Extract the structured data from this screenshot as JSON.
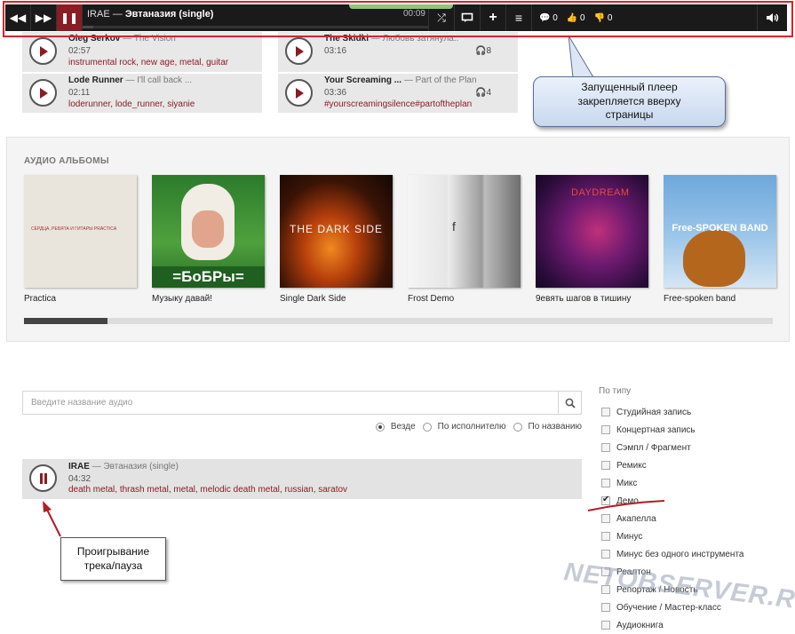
{
  "player": {
    "artist": "IRAE",
    "separator": "—",
    "title": "Эвтаназия (single)",
    "time": "00:09",
    "progress": 0.03,
    "comments": "0",
    "likes": "0",
    "dislikes": "0"
  },
  "tracks_top": [
    {
      "artist": "Oleg Serkov",
      "album": "The Vision",
      "duration": "02:57",
      "tags": "instrumental rock, new age, metal, guitar",
      "listens": ""
    },
    {
      "artist": "The Skidki",
      "album": "Любовь затянула..",
      "duration": "03:16",
      "tags": "",
      "listens": "8"
    },
    {
      "artist": "Lode Runner",
      "album": "I'll call back ...",
      "duration": "02:11",
      "tags": "loderunner, lode_runner, siyanie",
      "listens": ""
    },
    {
      "artist": "Your Screaming ...",
      "album": "Part of the Plan",
      "duration": "03:36",
      "tags": "#yourscreamingsilence#partoftheplan",
      "listens": "4"
    }
  ],
  "callout_text": "Запущенный плеер закрепляется вверху страницы",
  "albums": {
    "heading": "АУДИО АЛЬБОМЫ",
    "items": [
      {
        "name": "Practica",
        "cover_text": "СЕРДЦА, РЕБЯТА И ГИТАРЫ  PRACTICA"
      },
      {
        "name": "Музыку давай!",
        "cover_text": "=БоБРы="
      },
      {
        "name": "Single Dark Side",
        "cover_text": "THE DARK SIDE"
      },
      {
        "name": "Frost Demo",
        "cover_text": "f"
      },
      {
        "name": "9евять шагов в тишину",
        "cover_text": "DAYDREAM"
      },
      {
        "name": "Free-spoken band",
        "cover_text": "Free-SPOKEN BAND"
      }
    ]
  },
  "search": {
    "placeholder": "Введите название аудио",
    "value": ""
  },
  "radio_options": [
    "Везде",
    "По исполнителю",
    "По названию"
  ],
  "current_track": {
    "artist": "IRAE",
    "album": "Эвтаназия (single)",
    "duration": "04:32",
    "tags": "death metal, thrash metal, metal, melodic death metal, russian, saratov"
  },
  "filters": {
    "title": "По типу",
    "items": [
      {
        "label": "Студийная запись",
        "checked": false
      },
      {
        "label": "Концертная запись",
        "checked": false
      },
      {
        "label": "Сэмпл / Фрагмент",
        "checked": false
      },
      {
        "label": "Ремикс",
        "checked": false
      },
      {
        "label": "Микс",
        "checked": false
      },
      {
        "label": "Демо",
        "checked": true
      },
      {
        "label": "Акапелла",
        "checked": false
      },
      {
        "label": "Минус",
        "checked": false
      },
      {
        "label": "Минус без одного инструмента",
        "checked": false
      },
      {
        "label": "Реалтон",
        "checked": false
      },
      {
        "label": "Репортаж / Новость",
        "checked": false
      },
      {
        "label": "Обучение / Мастер-класс",
        "checked": false
      },
      {
        "label": "Аудиокнига",
        "checked": false
      }
    ]
  },
  "note_play": "Проигрывание трека/пауза",
  "watermark": "NETOBSERVER.RU",
  "colors": {
    "accent": "#8a1c23",
    "player_bg": "#1a1a1a",
    "highlight_frame": "#d9232a",
    "buffer": "#8bc87a"
  }
}
